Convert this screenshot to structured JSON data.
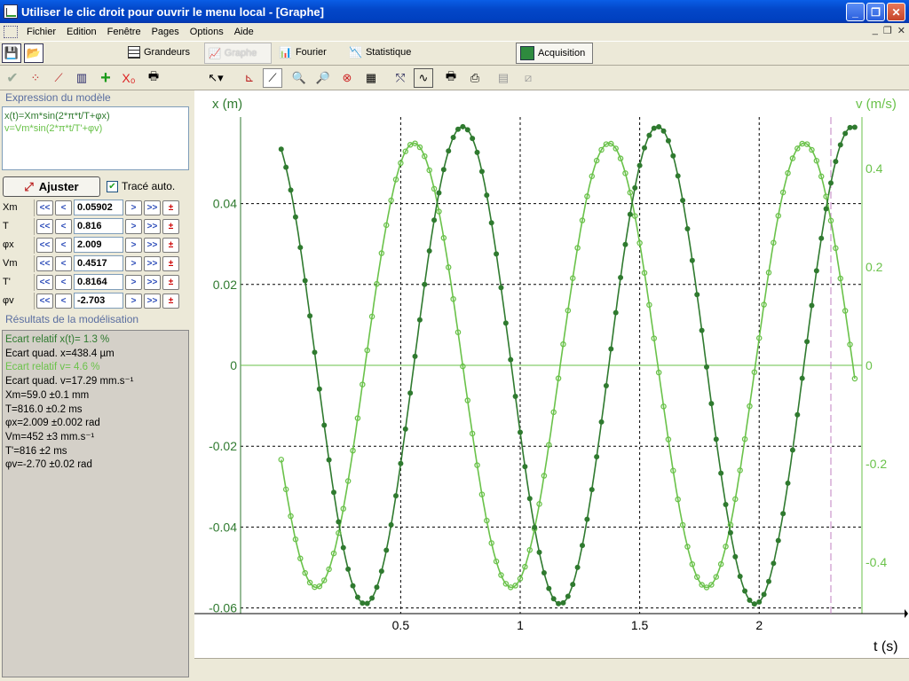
{
  "window": {
    "title": "Utiliser le clic droit pour ouvrir le menu local - [Graphe]"
  },
  "menu": [
    "Fichier",
    "Edition",
    "Fenêtre",
    "Pages",
    "Options",
    "Aide"
  ],
  "toolbar": {
    "grandeurs": "Grandeurs",
    "graphe": "Graphe",
    "fourier": "Fourier",
    "statistique": "Statistique",
    "acquisition": "Acquisition"
  },
  "left": {
    "model_title": "Expression du modèle",
    "expr1": "x(t)=Xm*sin(2*π*t/T+φx)",
    "expr2": "v=Vm*sin(2*π*t/T'+φv)",
    "ajuster": "Ajuster",
    "trace_auto": "Tracé auto.",
    "params": [
      {
        "name": "Xm",
        "value": "0.05902"
      },
      {
        "name": "T",
        "value": "0.816"
      },
      {
        "name": "φx",
        "value": "2.009"
      },
      {
        "name": "Vm",
        "value": "0.4517"
      },
      {
        "name": "T'",
        "value": "0.8164"
      },
      {
        "name": "φv",
        "value": "-2.703"
      }
    ],
    "results_title": "Résultats de la modélisation",
    "results": [
      "Ecart relatif x(t)= 1.3 %",
      "Ecart quad. x=438.4 µm",
      "Ecart relatif v= 4.6 %",
      "Ecart quad. v=17.29 mm.s⁻¹",
      "Xm=59.0 ±0.1 mm",
      "T=816.0 ±0.2 ms",
      "φx=2.009 ±0.002 rad",
      "Vm=452 ±3 mm.s⁻¹",
      "T'=816 ±2 ms",
      "φv=-2.70 ±0.02 rad"
    ]
  },
  "chart_data": {
    "type": "line",
    "ylabel": "x (m)",
    "y2label": "v (m/s)",
    "xlabel": "t (s)",
    "xlim": [
      -0.17,
      2.43
    ],
    "ylim": [
      -0.0614,
      0.0614
    ],
    "y2lim": [
      -0.505,
      0.505
    ],
    "xticks": [
      "0.5",
      "1",
      "1.5",
      "2"
    ],
    "xtick_values": [
      0.5,
      1,
      1.5,
      2
    ],
    "yticks": [
      "0.04",
      "0.02",
      "0",
      "-0.02",
      "-0.04",
      "-0.06"
    ],
    "ytick_values": [
      0.04,
      0.02,
      0,
      -0.02,
      -0.04,
      -0.06
    ],
    "y2ticks": [
      "0.4",
      "0.2",
      "0",
      "-0.2",
      "-0.4"
    ],
    "y2tick_values": [
      0.4,
      0.2,
      0,
      -0.2,
      -0.4
    ],
    "series": [
      {
        "Xm": 0.05902,
        "T": 0.816,
        "phi": 2.009,
        "t0": 0.0,
        "t1": 2.4,
        "dt": 0.02,
        "color": "#2f7a2f"
      },
      {
        "Vm": 0.4517,
        "T": 0.8164,
        "phi": -2.703,
        "t0": 0.0,
        "t1": 2.4,
        "dt": 0.02,
        "color": "#6ac24a"
      }
    ],
    "cursor_x": 2.3,
    "grid": true
  }
}
